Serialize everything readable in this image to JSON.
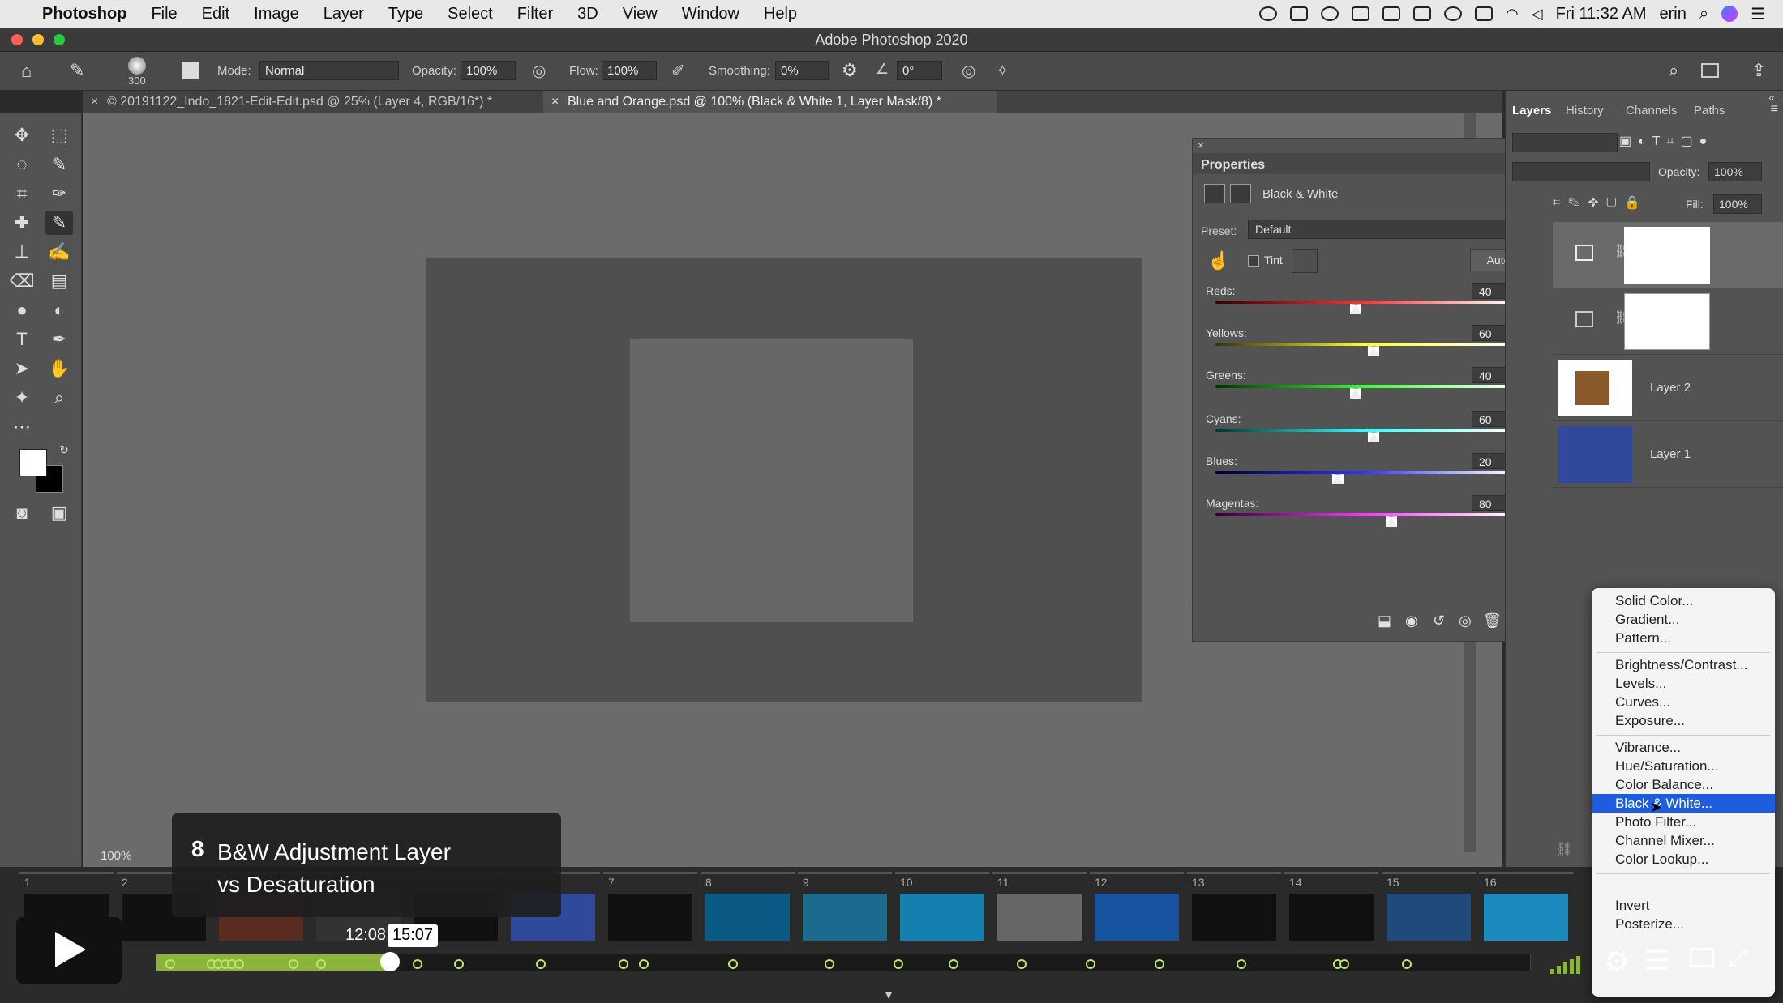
{
  "menubar": {
    "app": "Photoshop",
    "items": [
      "File",
      "Edit",
      "Image",
      "Layer",
      "Type",
      "Select",
      "Filter",
      "3D",
      "View",
      "Window",
      "Help"
    ],
    "clock": "Fri 11:32 AM",
    "user": "erin"
  },
  "window": {
    "title": "Adobe Photoshop 2020"
  },
  "options": {
    "brush_size": "300",
    "mode_label": "Mode:",
    "mode_value": "Normal",
    "opacity_label": "Opacity:",
    "opacity_value": "100%",
    "flow_label": "Flow:",
    "flow_value": "100%",
    "smoothing_label": "Smoothing:",
    "smoothing_value": "0%",
    "angle_value": "0°"
  },
  "tabs": [
    {
      "label": "© 20191122_Indo_1821-Edit-Edit.psd @ 25% (Layer 4, RGB/16*) *"
    },
    {
      "label": "Blue and Orange.psd @ 100% (Black & White 1, Layer Mask/8) *"
    }
  ],
  "canvas": {
    "zoom": "100%"
  },
  "properties": {
    "title": "Properties",
    "adjustment": "Black & White",
    "preset_label": "Preset:",
    "preset_value": "Default",
    "tint_label": "Tint",
    "auto_label": "Auto",
    "sliders": [
      {
        "label": "Reds:",
        "value": "40",
        "pct": 0.47
      },
      {
        "label": "Yellows:",
        "value": "60",
        "pct": 0.53
      },
      {
        "label": "Greens:",
        "value": "40",
        "pct": 0.47
      },
      {
        "label": "Cyans:",
        "value": "60",
        "pct": 0.53
      },
      {
        "label": "Blues:",
        "value": "20",
        "pct": 0.41
      },
      {
        "label": "Magentas:",
        "value": "80",
        "pct": 0.59
      }
    ]
  },
  "layers_panel": {
    "tabs": [
      "Layers",
      "History",
      "Channels",
      "Paths"
    ],
    "opacity_label": "Opacity:",
    "opacity_value": "100%",
    "fill_label": "Fill:",
    "fill_value": "100%",
    "layers": [
      {
        "name": "",
        "thumb_color": "#ffffff"
      },
      {
        "name": "",
        "thumb_color": "#ffffff"
      },
      {
        "name": "Layer 2",
        "thumb_color": "#8a5a2b"
      },
      {
        "name": "Layer 1",
        "thumb_color": "#2f4a9a"
      }
    ]
  },
  "adjustment_menu": {
    "groups": [
      [
        "Solid Color...",
        "Gradient...",
        "Pattern..."
      ],
      [
        "Brightness/Contrast...",
        "Levels...",
        "Curves...",
        "Exposure..."
      ],
      [
        "Vibrance...",
        "Hue/Saturation...",
        "Color Balance...",
        "Black & White...",
        "Photo Filter...",
        "Channel Mixer...",
        "Color Lookup..."
      ],
      [
        "Invert",
        "Posterize..."
      ]
    ],
    "selected": "Black & White..."
  },
  "video": {
    "chapter_number": "8",
    "chapter_title": "B&W Adjustment Layer vs Desaturation",
    "time_current": "12:08",
    "time_hover": "15:07",
    "progress_fraction": 0.17,
    "thumbnail_numbers": [
      "1",
      "2",
      "",
      "",
      "",
      "",
      "7",
      "8",
      "9",
      "10",
      "11",
      "12",
      "13",
      "14",
      "15",
      "16"
    ],
    "chapter_markers": [
      0.01,
      0.04,
      0.045,
      0.05,
      0.055,
      0.06,
      0.1,
      0.12,
      0.19,
      0.22,
      0.28,
      0.34,
      0.355,
      0.42,
      0.49,
      0.54,
      0.58,
      0.63,
      0.68,
      0.73,
      0.79,
      0.86,
      0.865,
      0.91
    ]
  },
  "colors": {
    "accent_green": "#8ab43c",
    "menu_select": "#1e5ede"
  }
}
